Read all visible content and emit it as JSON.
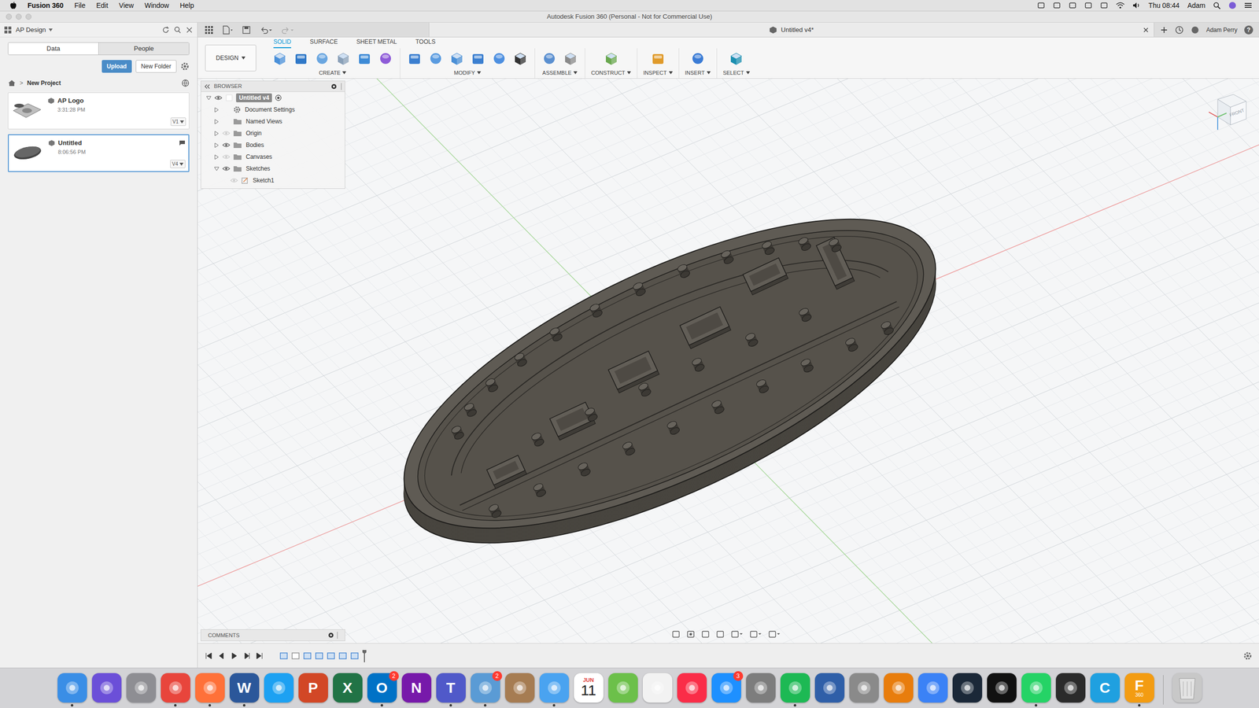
{
  "menubar": {
    "app": "Fusion 360",
    "items": [
      "File",
      "Edit",
      "View",
      "Window",
      "Help"
    ],
    "clock": "Thu 08:44",
    "user": "Adam"
  },
  "window": {
    "title": "Autodesk Fusion 360 (Personal - Not for Commercial Use)"
  },
  "dataPanel": {
    "team": "AP Design",
    "tabs": [
      {
        "label": "Data",
        "selected": true
      },
      {
        "label": "People",
        "selected": false
      }
    ],
    "buttons": [
      {
        "label": "Upload",
        "primary": true
      },
      {
        "label": "New Folder",
        "primary": false
      }
    ],
    "breadcrumb": {
      "separator": ">",
      "label": "New Project"
    },
    "files": [
      {
        "name": "AP Logo",
        "time": "3:31:28 PM",
        "version": "V1",
        "selected": false
      },
      {
        "name": "Untitled",
        "time": "8:06:56 PM",
        "version": "V4",
        "selected": true
      }
    ]
  },
  "documentTab": {
    "label": "Untitled v4*",
    "user": "Adam Perry",
    "help": "?"
  },
  "ribbon": {
    "workspace": "DESIGN",
    "tabs": [
      {
        "label": "SOLID",
        "selected": true
      },
      {
        "label": "SURFACE",
        "selected": false
      },
      {
        "label": "SHEET METAL",
        "selected": false
      },
      {
        "label": "TOOLS",
        "selected": false
      }
    ],
    "groups": [
      {
        "label": "CREATE",
        "tools": 6
      },
      {
        "label": "MODIFY",
        "tools": 6
      },
      {
        "label": "ASSEMBLE",
        "tools": 2
      },
      {
        "label": "CONSTRUCT",
        "tools": 1
      },
      {
        "label": "INSPECT",
        "tools": 1
      },
      {
        "label": "INSERT",
        "tools": 1
      },
      {
        "label": "SELECT",
        "tools": 1
      }
    ]
  },
  "browser": {
    "title": "BROWSER",
    "tree": {
      "label": "Untitled v4",
      "kind": "document",
      "selected": true,
      "expanded": true,
      "visible": true,
      "children": [
        {
          "label": "Document Settings",
          "kind": "settings",
          "selected": false,
          "expanded": false
        },
        {
          "label": "Named Views",
          "kind": "views",
          "selected": false,
          "expanded": false
        },
        {
          "label": "Origin",
          "kind": "folder",
          "selected": false,
          "expanded": false,
          "visible": false
        },
        {
          "label": "Bodies",
          "kind": "folder",
          "selected": false,
          "expanded": false,
          "visible": true
        },
        {
          "label": "Canvases",
          "kind": "folder",
          "selected": false,
          "expanded": false,
          "visible": false
        },
        {
          "label": "Sketches",
          "kind": "folder",
          "selected": false,
          "expanded": true,
          "visible": true,
          "children": [
            {
              "label": "Sketch1",
              "kind": "sketch",
              "selected": false,
              "expanded": false,
              "visible": false
            }
          ]
        }
      ]
    }
  },
  "comments": {
    "title": "COMMENTS"
  },
  "viewcube": {
    "face": "FRONT"
  },
  "dock": [
    {
      "kind": "app",
      "color": "#3a8ee6",
      "running": true
    },
    {
      "kind": "app",
      "color": "#6b4fd8",
      "running": false
    },
    {
      "kind": "app",
      "color": "#8e8e93",
      "running": false
    },
    {
      "kind": "app",
      "color": "#e8453c",
      "running": true
    },
    {
      "kind": "app",
      "color": "#ff7139",
      "running": true
    },
    {
      "kind": "app",
      "color": "#2b579a",
      "glyph": "W",
      "running": true
    },
    {
      "kind": "app",
      "color": "#1da1f2",
      "running": false
    },
    {
      "kind": "app",
      "color": "#d24726",
      "glyph": "P",
      "running": false
    },
    {
      "kind": "app",
      "color": "#217346",
      "glyph": "X",
      "running": false
    },
    {
      "kind": "app",
      "color": "#0072c6",
      "glyph": "O",
      "badge": "2",
      "running": true
    },
    {
      "kind": "app",
      "color": "#7719aa",
      "glyph": "N",
      "running": false
    },
    {
      "kind": "app",
      "color": "#5059c9",
      "glyph": "T",
      "running": true
    },
    {
      "kind": "app",
      "color": "#5a9bd5",
      "badge": "2",
      "running": true
    },
    {
      "kind": "app",
      "color": "#a67c52",
      "running": false
    },
    {
      "kind": "app",
      "color": "#4aa3f0",
      "running": true
    },
    {
      "kind": "calendar",
      "color": "#ffffff",
      "month": "JUN",
      "day": "11",
      "running": false
    },
    {
      "kind": "app",
      "color": "#6cc04a",
      "running": false
    },
    {
      "kind": "app",
      "color": "#f2f2f2",
      "running": false
    },
    {
      "kind": "app",
      "color": "#fa2d48",
      "running": false
    },
    {
      "kind": "app",
      "color": "#1e90ff",
      "badge": "3",
      "running": false
    },
    {
      "kind": "app",
      "color": "#7d7d7d",
      "running": false
    },
    {
      "kind": "app",
      "color": "#1db954",
      "running": true
    },
    {
      "kind": "app",
      "color": "#2f5fa8",
      "running": false
    },
    {
      "kind": "app",
      "color": "#8a8a8a",
      "running": false
    },
    {
      "kind": "app",
      "color": "#e87d0d",
      "running": false
    },
    {
      "kind": "app",
      "color": "#3b82f6",
      "running": false
    },
    {
      "kind": "app",
      "color": "#1b2838",
      "running": false
    },
    {
      "kind": "app",
      "color": "#111111",
      "running": false
    },
    {
      "kind": "app",
      "color": "#25d366",
      "running": true
    },
    {
      "kind": "app",
      "color": "#2b2b2b",
      "running": false
    },
    {
      "kind": "app",
      "color": "#1fa0e0",
      "glyph": "C",
      "running": false
    },
    {
      "kind": "app",
      "color": "#f39c12",
      "glyph": "F",
      "sub": "360",
      "running": true
    },
    {
      "kind": "trash",
      "color": "#c8c8c8",
      "running": false
    }
  ]
}
